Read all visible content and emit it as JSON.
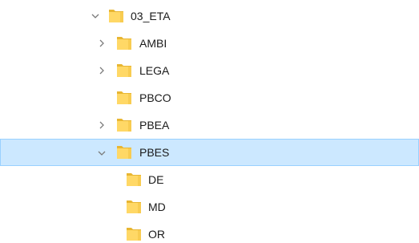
{
  "tree": {
    "items": [
      {
        "label": "03_ETA",
        "expander": "chevron-down-icon",
        "depth": 0,
        "selected": false
      },
      {
        "label": "AMBI",
        "expander": "chevron-right-icon",
        "depth": 1,
        "selected": false
      },
      {
        "label": "LEGA",
        "expander": "chevron-right-icon",
        "depth": 1,
        "selected": false
      },
      {
        "label": "PBCO",
        "expander": "",
        "depth": 1,
        "selected": false
      },
      {
        "label": "PBEA",
        "expander": "chevron-right-icon",
        "depth": 1,
        "selected": false
      },
      {
        "label": "PBES",
        "expander": "chevron-down-icon",
        "depth": 1,
        "selected": true
      },
      {
        "label": "DE",
        "expander": "",
        "depth": 2,
        "selected": false
      },
      {
        "label": "MD",
        "expander": "",
        "depth": 2,
        "selected": false
      },
      {
        "label": "OR",
        "expander": "",
        "depth": 2,
        "selected": false
      }
    ]
  },
  "colors": {
    "selection_background": "#cce8ff",
    "selection_border": "#99d1ff",
    "folder_fill": "#ffd866",
    "folder_back": "#e8b632",
    "chevron": "#7a7a7a",
    "text": "#1a1a1a"
  }
}
